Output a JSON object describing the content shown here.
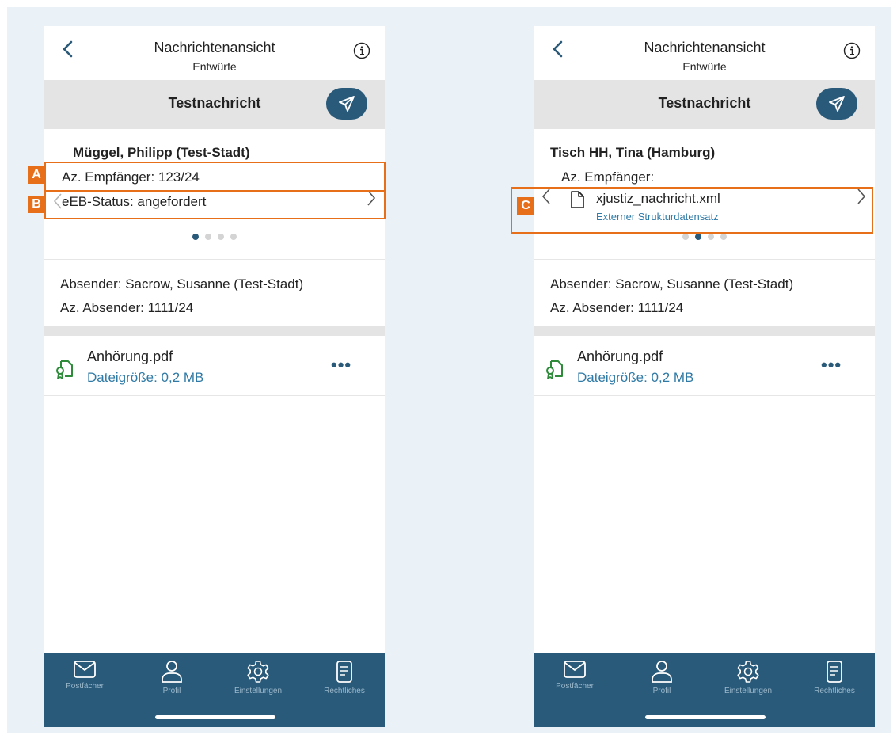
{
  "screens": [
    {
      "header": {
        "title": "Nachrichtenansicht",
        "subtitle": "Entwürfe"
      },
      "subject": "Testnachricht",
      "recipient": {
        "name": "Müggel, Philipp (Test-Stadt)",
        "az_empfaenger": "Az. Empfänger: 123/24",
        "eeb_status": "eEB-Status: angefordert"
      },
      "sender": {
        "absender": "Absender: Sacrow, Susanne (Test-Stadt)",
        "az_absender": "Az. Absender: 1111/24"
      },
      "attachment": {
        "name": "Anhörung.pdf",
        "size": "Dateigröße: 0,2 MB",
        "more": "•••"
      },
      "markers": [
        "A",
        "B"
      ]
    },
    {
      "header": {
        "title": "Nachrichtenansicht",
        "subtitle": "Entwürfe"
      },
      "subject": "Testnachricht",
      "recipient": {
        "name": "Tisch HH, Tina (Hamburg)",
        "az_empfaenger": "Az. Empfänger:",
        "file_name": "xjustiz_nachricht.xml",
        "file_type": "Externer Strukturdatensatz"
      },
      "sender": {
        "absender": "Absender: Sacrow, Susanne (Test-Stadt)",
        "az_absender": "Az. Absender: 1111/24"
      },
      "attachment": {
        "name": "Anhörung.pdf",
        "size": "Dateigröße: 0,2 MB",
        "more": "•••"
      },
      "markers": [
        "C"
      ]
    }
  ],
  "carousel": {
    "total_pages": 4,
    "active_page_left": 1,
    "active_page_right": 2
  },
  "tabbar": {
    "postfaecher": "Postfächer",
    "profil": "Profil",
    "einstellungen": "Einstellungen",
    "rechtliches": "Rechtliches"
  },
  "colors": {
    "primary": "#2a5a7a",
    "link": "#2f7aa6",
    "highlight": "#e86f1a",
    "background": "#eaf1f7"
  }
}
